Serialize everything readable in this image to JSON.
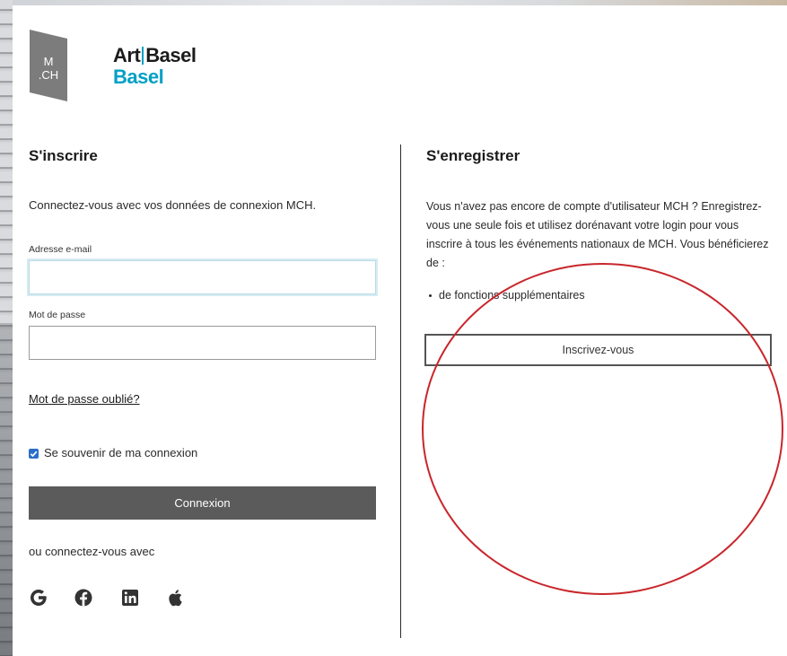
{
  "logos": {
    "mch_text_top": "M",
    "mch_text_bottom": ".CH",
    "brand_part1": "Art",
    "brand_part2": "Basel",
    "brand_line2": "Basel",
    "mch_icon": "mch-logo-icon"
  },
  "login": {
    "title": "S'inscrire",
    "intro": "Connectez-vous avec vos données de connexion MCH.",
    "email_label": "Adresse e-mail",
    "email_value": "",
    "password_label": "Mot de passe",
    "password_value": "",
    "forgot_link": "Mot de passe oublié?",
    "remember_label": "Se souvenir de ma connexion",
    "remember_checked": true,
    "submit_label": "Connexion",
    "social_label": "ou connectez-vous avec",
    "social_icons": [
      "google-icon",
      "facebook-icon",
      "linkedin-icon",
      "apple-icon"
    ]
  },
  "register": {
    "title": "S'enregistrer",
    "paragraph": "Vous n'avez pas encore de compte d'utilisateur MCH ? Enregistrez-vous une seule fois et utilisez dorénavant votre login pour vous inscrire à tous les événements nationaux de MCH. Vous bénéficierez de :",
    "bullet": "de fonctions supplémentaires",
    "button_label": "Inscrivez-vous"
  },
  "colors": {
    "accent": "#00a0c6",
    "dark_button": "#5b5b5b",
    "annotation": "#c8262b",
    "checkbox": "#2a6fc9"
  }
}
